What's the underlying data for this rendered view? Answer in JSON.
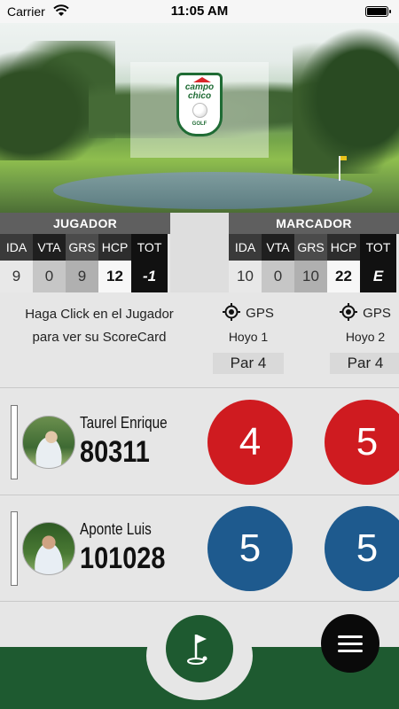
{
  "status_bar": {
    "carrier": "Carrier",
    "time": "11:05 AM"
  },
  "logo": {
    "line1": "campo",
    "line2": "chico",
    "line3": "GOLF"
  },
  "jugador": {
    "title": "JUGADOR",
    "columns": [
      "IDA",
      "VTA",
      "GRS",
      "HCP",
      "TOT"
    ],
    "values": [
      "9",
      "0",
      "9",
      "12",
      "-1"
    ]
  },
  "marcador": {
    "title": "MARCADOR",
    "columns": [
      "IDA",
      "VTA",
      "GRS",
      "HCP",
      "TOT"
    ],
    "values": [
      "10",
      "0",
      "10",
      "22",
      "E"
    ]
  },
  "instructions": "Haga Click en el Jugador para ver su ScoreCard",
  "holes": [
    {
      "gps_label": "GPS",
      "hole_label": "Hoyo 1",
      "par_label": "Par 4"
    },
    {
      "gps_label": "GPS",
      "hole_label": "Hoyo 2",
      "par_label": "Par 4"
    }
  ],
  "players": [
    {
      "name": "Taurel Enrique",
      "id": "80311",
      "scores": [
        "4",
        "5"
      ]
    },
    {
      "name": "Aponte Luis",
      "id": "101028",
      "scores": [
        "5",
        "5"
      ]
    }
  ],
  "icons": {
    "wifi": "wifi-icon",
    "battery": "battery-icon",
    "target": "gps-target-icon",
    "flag": "golf-flag-icon",
    "menu": "hamburger-menu-icon"
  },
  "colors": {
    "score_red": "#cf1b20",
    "score_blue": "#1e5a8e",
    "brand_green": "#1e5a30"
  }
}
